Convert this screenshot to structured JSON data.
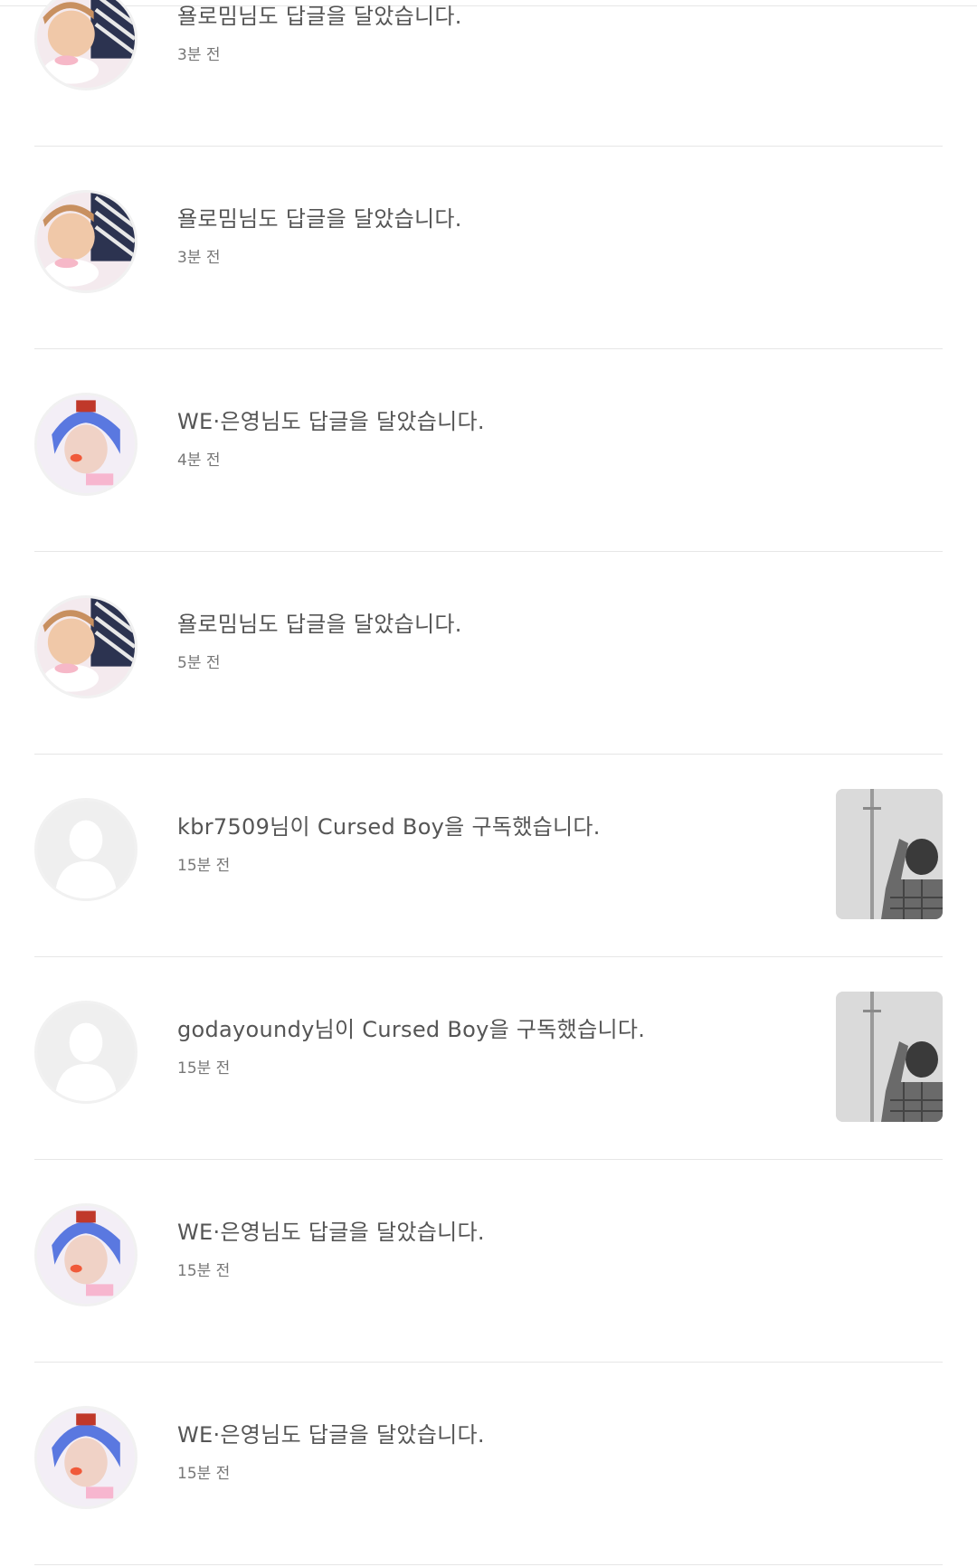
{
  "notifications": [
    {
      "avatar": "avatar-photo-pastel-pillow",
      "message": "욜로밈님도 답글을 달았습니다.",
      "time": "3분 전",
      "thumbnail": null
    },
    {
      "avatar": "avatar-photo-pastel-pillow",
      "message": "욜로밈님도 답글을 달았습니다.",
      "time": "3분 전",
      "thumbnail": null
    },
    {
      "avatar": "avatar-photo-blue-hair",
      "message": "WE·은영님도 답글을 달았습니다.",
      "time": "4분 전",
      "thumbnail": null
    },
    {
      "avatar": "avatar-photo-pastel-pillow",
      "message": "욜로밈님도 답글을 달았습니다.",
      "time": "5분 전",
      "thumbnail": null
    },
    {
      "avatar": "default-user-icon",
      "message": "kbr7509님이 Cursed Boy을 구독했습니다.",
      "time": "15분 전",
      "thumbnail": "story-cover-image"
    },
    {
      "avatar": "default-user-icon",
      "message": "godayoundy님이 Cursed Boy을 구독했습니다.",
      "time": "15분 전",
      "thumbnail": "story-cover-image"
    },
    {
      "avatar": "avatar-photo-blue-hair",
      "message": "WE·은영님도 답글을 달았습니다.",
      "time": "15분 전",
      "thumbnail": null
    },
    {
      "avatar": "avatar-photo-blue-hair",
      "message": "WE·은영님도 답글을 달았습니다.",
      "time": "15분 전",
      "thumbnail": null
    }
  ],
  "colors": {
    "text": "#555555",
    "subtext": "#777777",
    "divider": "#e6e6e6",
    "background": "#ffffff"
  }
}
